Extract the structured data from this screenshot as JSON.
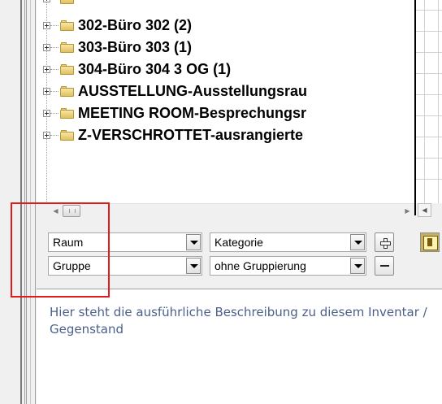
{
  "tree": {
    "items": [
      {
        "label": "302-Büro 302  (2)",
        "icon": "folder-icon"
      },
      {
        "label": "303-Büro 303  (1)",
        "icon": "folder-icon"
      },
      {
        "label": "304-Büro 304  3 OG  (1)",
        "icon": "folder-icon"
      },
      {
        "label": "AUSSTELLUNG-Ausstellungsrau",
        "icon": "folder-icon"
      },
      {
        "label": "MEETING ROOM-Besprechungsr",
        "icon": "folder-icon"
      },
      {
        "label": "Z-VERSCHROTTET-ausrangierte",
        "icon": "folder-icon"
      }
    ]
  },
  "filters": {
    "primary_field": "Raum",
    "category_field": "Kategorie",
    "group_field": "Gruppe",
    "grouping_field": "ohne Gruppierung"
  },
  "description": {
    "text": "Hier steht die ausführliche Beschreibung zu diesem Inventar / Gegenstand"
  },
  "colors": {
    "highlight": "#e11b1b",
    "description_text": "#4a5f8a"
  }
}
